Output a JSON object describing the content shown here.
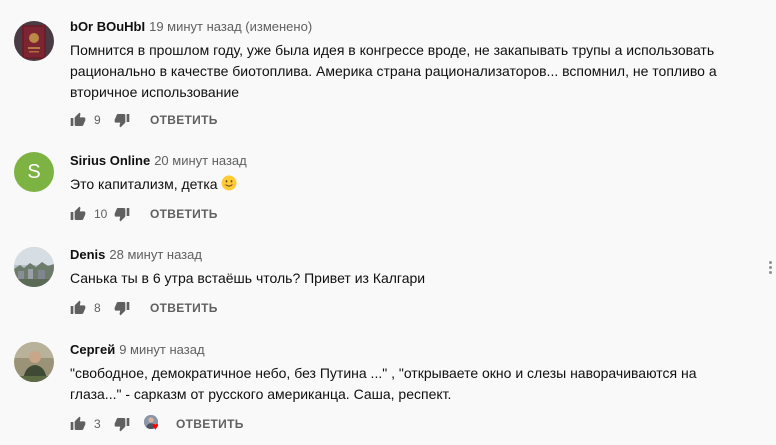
{
  "comments": [
    {
      "author": "bOr BOuHbI",
      "time": "19 минут назад (изменено)",
      "text": "Помнится в прошлом году, уже была идея в конгрессе вроде, не закапывать трупы а использовать рационально в качестве биотоплива. Америка страна рационализаторов... вспомнил, не топливо а вторичное использование",
      "likes": "9",
      "reply": "ОТВЕТИТЬ",
      "avatar_icon": "passport-photo"
    },
    {
      "author": "Sirius Online",
      "time": "20 минут назад",
      "text": "Это капитализм, детка",
      "emoji_icon": "smiling-face-icon",
      "likes": "10",
      "reply": "ОТВЕТИТЬ",
      "avatar_letter": "S",
      "avatar_color": "#7cb342"
    },
    {
      "author": "Denis",
      "time": "28 минут назад",
      "text": "Санька ты в 6 утра встаёшь чтоль? Привет из Калгари",
      "likes": "8",
      "reply": "ОТВЕТИТЬ",
      "avatar_icon": "city-photo"
    },
    {
      "author": "Сергей",
      "time": "9 минут назад",
      "text": "\"свободное, демократичное небо, без  Путина ...\" , \"открываете окно и слезы наворачиваются на глаза...\" - сарказм от русского американца. Саша, респект.",
      "likes": "3",
      "reply": "ОТВЕТИТЬ",
      "avatar_icon": "person-photo",
      "creator_heart": true
    }
  ],
  "colors": {
    "background": "#f9f9f9",
    "text": "#0f0f0f",
    "secondary": "#606060",
    "heart": "#ff0000"
  }
}
